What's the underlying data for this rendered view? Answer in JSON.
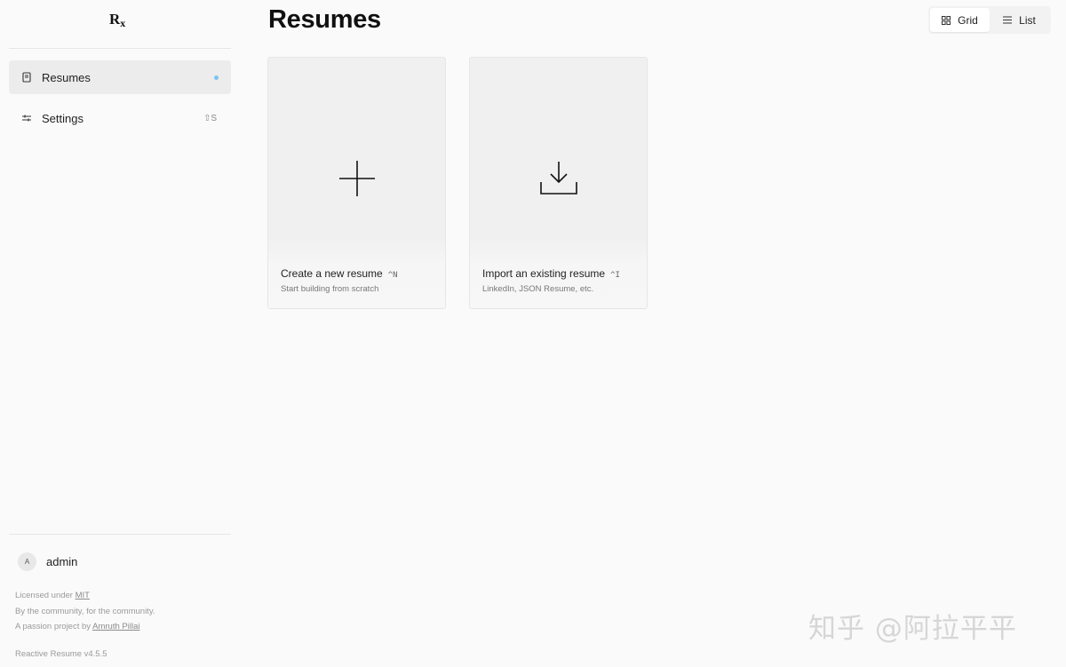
{
  "sidebar": {
    "logo": {
      "main": "R",
      "sub": "x"
    },
    "items": [
      {
        "label": "Resumes",
        "active": true,
        "icon": "resume-icon"
      },
      {
        "label": "Settings",
        "shortcut": "⇧S",
        "icon": "sliders-icon"
      }
    ],
    "user": {
      "initial": "A",
      "name": "admin"
    },
    "footer": {
      "license_prefix": "Licensed under ",
      "license_link": "MIT",
      "community": "By the community, for the community.",
      "project_prefix": "A passion project by ",
      "author_link": "Amruth Pillai",
      "version": "Reactive Resume v4.5.5"
    }
  },
  "main": {
    "title": "Resumes",
    "view_toggle": {
      "grid_label": "Grid",
      "list_label": "List",
      "selected": "Grid"
    },
    "cards": [
      {
        "title": "Create a new resume",
        "shortcut": "^N",
        "subtitle": "Start building from scratch",
        "icon": "plus-icon"
      },
      {
        "title": "Import an existing resume",
        "shortcut": "^I",
        "subtitle": "LinkedIn, JSON Resume, etc.",
        "icon": "download-icon"
      }
    ]
  },
  "watermark": "知乎 @阿拉平平",
  "colors": {
    "background": "#fafafa",
    "active_nav": "#ececec",
    "indicator_dot": "#7cc3f2",
    "card": "#f0f0f0"
  }
}
